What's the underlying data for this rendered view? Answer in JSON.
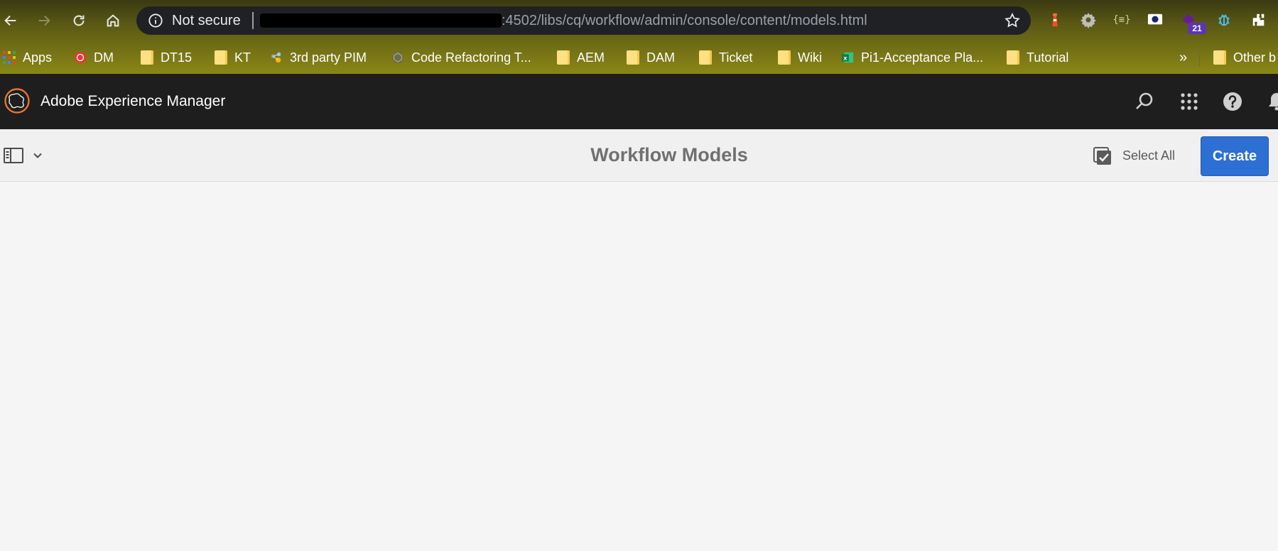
{
  "browser": {
    "security_label": "Not secure",
    "url_visible": ":4502/libs/cq/workflow/admin/console/content/models.html",
    "extension_badge": "21"
  },
  "bookmarks": [
    {
      "label": "Apps",
      "icon": "apps-grid-icon"
    },
    {
      "label": "DM",
      "icon": "dm-icon"
    },
    {
      "label": "DT15",
      "icon": "folder-icon"
    },
    {
      "label": "KT",
      "icon": "folder-icon"
    },
    {
      "label": "3rd party PIM",
      "icon": "pim-icon"
    },
    {
      "label": "Code Refactoring T...",
      "icon": "code-refactoring-icon"
    },
    {
      "label": "AEM",
      "icon": "folder-icon"
    },
    {
      "label": "DAM",
      "icon": "folder-icon"
    },
    {
      "label": "Ticket",
      "icon": "folder-icon"
    },
    {
      "label": "Wiki",
      "icon": "folder-icon"
    },
    {
      "label": "Pi1-Acceptance Pla...",
      "icon": "excel-icon"
    },
    {
      "label": "Tutorial",
      "icon": "folder-icon"
    }
  ],
  "bookmarks_overflow": "»",
  "other_bookmarks": "Other b",
  "shell": {
    "product_name": "Adobe Experience Manager"
  },
  "actionbar": {
    "title": "Workflow Models",
    "select_all": "Select All",
    "create": "Create"
  },
  "colors": {
    "shell_bg": "#1e1e1e",
    "primary_button": "#2d6fd2",
    "title_text": "#707070",
    "aem_logo": "#e8742d"
  }
}
